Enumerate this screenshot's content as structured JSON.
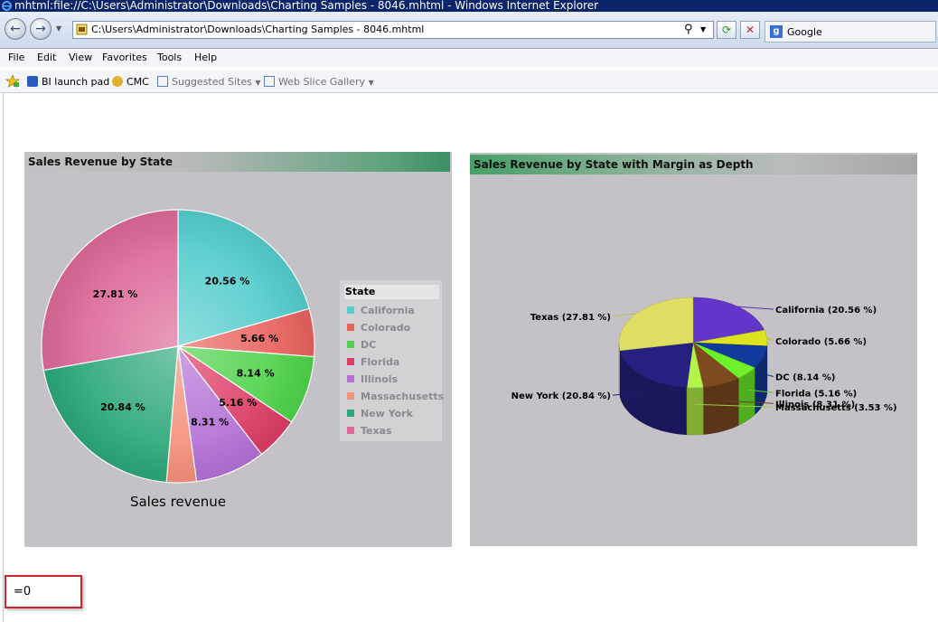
{
  "window": {
    "title": "mhtml:file://C:\\Users\\Administrator\\Downloads\\Charting Samples - 8046.mhtml - Windows Internet Explorer"
  },
  "address_bar": {
    "url": "C:\\Users\\Administrator\\Downloads\\Charting Samples - 8046.mhtml"
  },
  "search": {
    "provider": "Google"
  },
  "menu": [
    "File",
    "Edit",
    "View",
    "Favorites",
    "Tools",
    "Help"
  ],
  "favorites_bar": {
    "items": [
      "BI launch pad",
      "CMC",
      "Suggested Sites",
      "Web Slice Gallery"
    ]
  },
  "chart_data": [
    {
      "type": "pie",
      "title": "Sales Revenue by State",
      "xlabel": "Sales revenue",
      "legend_title": "State",
      "legend_position": "right",
      "categories": [
        "California",
        "Colorado",
        "DC",
        "Florida",
        "Illinois",
        "Massachusetts",
        "New York",
        "Texas"
      ],
      "values": [
        20.56,
        5.66,
        8.14,
        5.16,
        8.31,
        3.53,
        20.84,
        27.81
      ],
      "data_labels": [
        "20.56 %",
        "5.66 %",
        "8.14 %",
        "5.16 %",
        "8.31 %",
        "",
        "20.84 %",
        "27.81 %"
      ],
      "colors": [
        "#54cccc",
        "#e8625e",
        "#4ed24a",
        "#dc3c64",
        "#b470d6",
        "#f5907a",
        "#2ca87a",
        "#dc6898"
      ]
    },
    {
      "type": "pie",
      "title": "Sales Revenue by State with Margin as Depth",
      "categories": [
        "California",
        "Colorado",
        "DC",
        "Florida",
        "Illinois",
        "Massachusetts",
        "New York",
        "Texas"
      ],
      "values": [
        20.56,
        5.66,
        8.14,
        5.16,
        8.31,
        3.53,
        20.84,
        27.81
      ],
      "data_labels": [
        "California (20.56 %)",
        "Colorado (5.66 %)",
        "DC (8.14 %)",
        "Florida (5.16 %)",
        "Illinois (8.31 %)",
        "Massachusetts (3.53 %)",
        "New York (20.84 %)",
        "Texas  (27.81 %)"
      ],
      "colors": [
        "#6236c8",
        "#dde41e",
        "#123a9a",
        "#6ef02a",
        "#7e4a20",
        "#b4f24c",
        "#262080",
        "#dede64"
      ]
    }
  ],
  "formula_cell": {
    "value": "=0"
  },
  "colors": {
    "title_bar": "#0b246a",
    "chart_background": "#c4c2c6",
    "formula_border": "#c8262a"
  }
}
